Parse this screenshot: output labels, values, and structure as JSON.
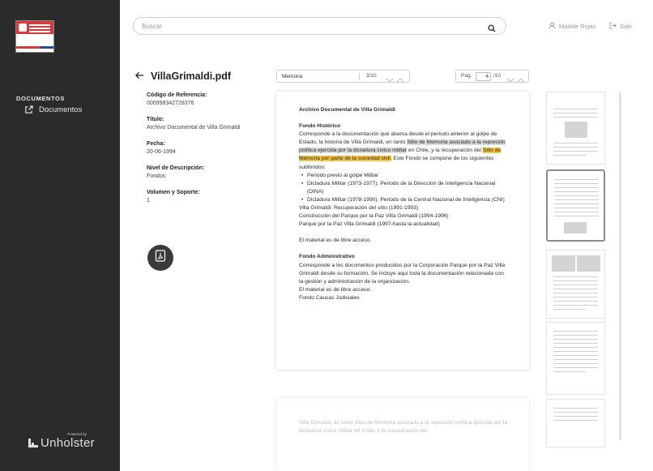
{
  "sidebar": {
    "logo_alt": "Subsecretaría de Derechos Humanos - Gobierno de Chile",
    "section_label": "DOCUMENTOS",
    "items": [
      {
        "label": "Documentos",
        "icon": "external-link-icon"
      }
    ],
    "powered_by": "Powered by",
    "brand": "Unholster"
  },
  "header": {
    "search_placeholder": "Buscar",
    "user_name": "Matilde Rojas",
    "logout_label": "Salir"
  },
  "document": {
    "title": "VillaGrimaldi.pdf",
    "metadata": [
      {
        "label": "Código de Referencia:",
        "value": "000998342728376"
      },
      {
        "label": "Título:",
        "value": "Archivo Documental de Villa Grimaldi"
      },
      {
        "label": "Fecha:",
        "value": "20-06-1994"
      },
      {
        "label": "Nivel de Descripción:",
        "value": "Fondos"
      },
      {
        "label": "Volumen y Soporte:",
        "value": "1"
      }
    ]
  },
  "viewer": {
    "find_value": "Memoria",
    "find_count": "3/10",
    "page_label": "Pág.",
    "page_current": "4",
    "page_total": "/10",
    "page_heading": "Archivo Documental de Villa Grimaldi",
    "fondo_historico_title": "Fondo Histórico",
    "fh_text_1": "Corresponde a la documentación que abarca desde el periodo anterior al golpe de Estado, la historia de Villa Grimaldi, en tanto ",
    "fh_highlight_1": "Sitio de Memoria asociado a la represión política ejercida por la dictadura cívico militar",
    "fh_text_2": " en Chile, y la recuperación del ",
    "fh_highlight_2": "Sitio de Memoria por parte de la sociedad civil.",
    "fh_text_3": " Este Fondo se compone de los siguientes subfondos:",
    "subfondos": [
      "Periodo previo al golpe Militar",
      "Dictadura Militar (1973-1977). Periodo de la Dirección de Inteligencia Nacional (DINA)",
      "Dictadura Militar (1978-1990). Periodo de la Central Nacional de Inteligencia (CNI)"
    ],
    "fh_lines": [
      "Villa Grimaldi: Recuperación del sitio (1991-1993)",
      "Construcción del Parque por la Paz Villa Grimaldi (1994-1996)",
      "Parque por la Paz Villa Grimaldi (1997-hasta la actualidad)"
    ],
    "libre_acceso_1": "El material es de libre acceso.",
    "fondo_admin_title": "Fondo Administrativo",
    "fa_text": "Corresponde a los documentos producidos por la Corporación Parque por la Paz Villa Grimaldi desde su formación. Se incluye aquí toda la documentación relacionada con la gestión y administración de la organización.",
    "libre_acceso_2": "El material es de libre acceso.",
    "fondo_causas": "Fondo Causas Judiciales",
    "next_page_text": "Villa Grimaldi, en tanto Sitio de Memoria asociado a la represión política ejercida por la dictadura cívico militar en Chile, y la recuperación del"
  },
  "colors": {
    "sidebar_bg": "#2b2b2b",
    "highlight_active": "#f4c542",
    "highlight_other": "#d9d9d9"
  }
}
